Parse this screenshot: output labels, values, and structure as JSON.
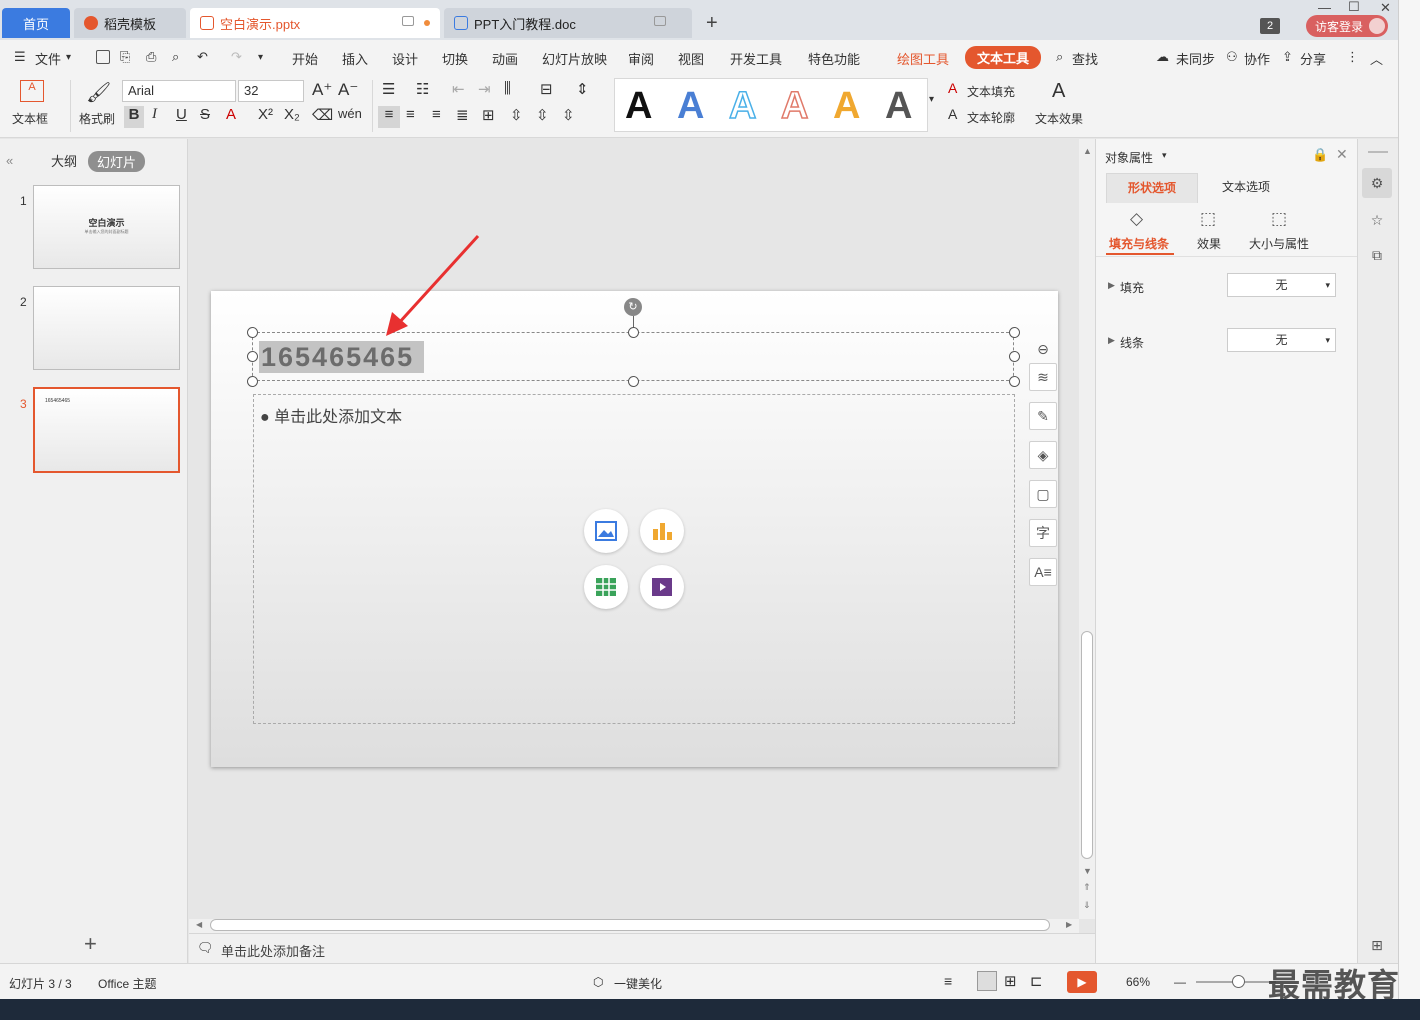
{
  "tabs": {
    "home": "首页",
    "daoke": "稻壳模板",
    "pptx": "空白演示.pptx",
    "doc": "PPT入门教程.doc",
    "count_badge": "2",
    "login": "访客登录"
  },
  "menu": {
    "file": "文件",
    "items": [
      "开始",
      "插入",
      "设计",
      "切换",
      "动画",
      "幻灯片放映",
      "审阅",
      "视图",
      "开发工具",
      "特色功能"
    ],
    "drawing_tools": "绘图工具",
    "text_tools": "文本工具",
    "search": "查找",
    "sync": "未同步",
    "collab": "协作",
    "share": "分享"
  },
  "ribbon": {
    "textbox": "文本框",
    "format_painter": "格式刷",
    "font_name": "Arial",
    "font_size": "32",
    "text_fill": "文本填充",
    "text_outline": "文本轮廓",
    "text_effect": "文本效果",
    "wordart_glyph": "A"
  },
  "left_panel": {
    "outline_tab": "大纲",
    "slides_tab": "幻灯片",
    "thumbs": [
      {
        "num": "1",
        "title": "空白演示",
        "subtitle": "单击输入您的封面副标题"
      },
      {
        "num": "2",
        "title": ""
      },
      {
        "num": "3",
        "title": "165465465"
      }
    ],
    "add": "+"
  },
  "slide": {
    "title": "165465465",
    "content_placeholder": "单击此处添加文本"
  },
  "notes_placeholder": "单击此处添加备注",
  "right_pane": {
    "header": "对象属性",
    "tab_shape": "形状选项",
    "tab_text": "文本选项",
    "sub_fill_line": "填充与线条",
    "sub_effect": "效果",
    "sub_size": "大小与属性",
    "fill_label": "填充",
    "fill_value": "无",
    "line_label": "线条",
    "line_value": "无"
  },
  "status": {
    "slide_pos": "幻灯片 3 / 3",
    "theme": "Office 主题",
    "beautify": "一键美化",
    "zoom": "66%"
  },
  "watermark": "最需教育",
  "colors": {
    "accent": "#e4572e",
    "home_tab": "#3b7be0",
    "login": "#d96060"
  }
}
